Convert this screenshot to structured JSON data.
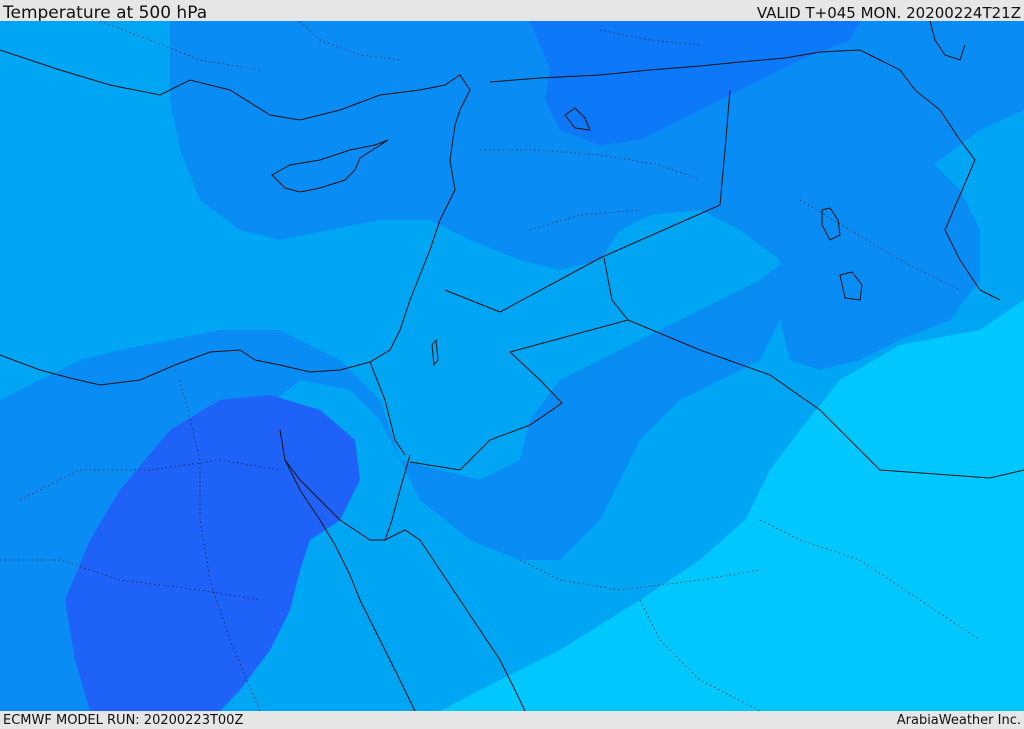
{
  "header": {
    "title": "Temperature at 500 hPa",
    "valid_time": "VALID T+045 MON. 20200224T21Z"
  },
  "footer": {
    "model_run": "ECMWF MODEL RUN: 20200223T00Z",
    "credit": "ArabiaWeather Inc."
  },
  "map": {
    "field": "temperature-500hPa",
    "colors": {
      "base": "#00a6f4",
      "band_light": "#00c8ff",
      "band_mid": "#0a8cf5",
      "band_dark": "#1e62f8",
      "band_cold": "#0d78f8",
      "coastline": "#111111",
      "border": "#111111"
    }
  }
}
